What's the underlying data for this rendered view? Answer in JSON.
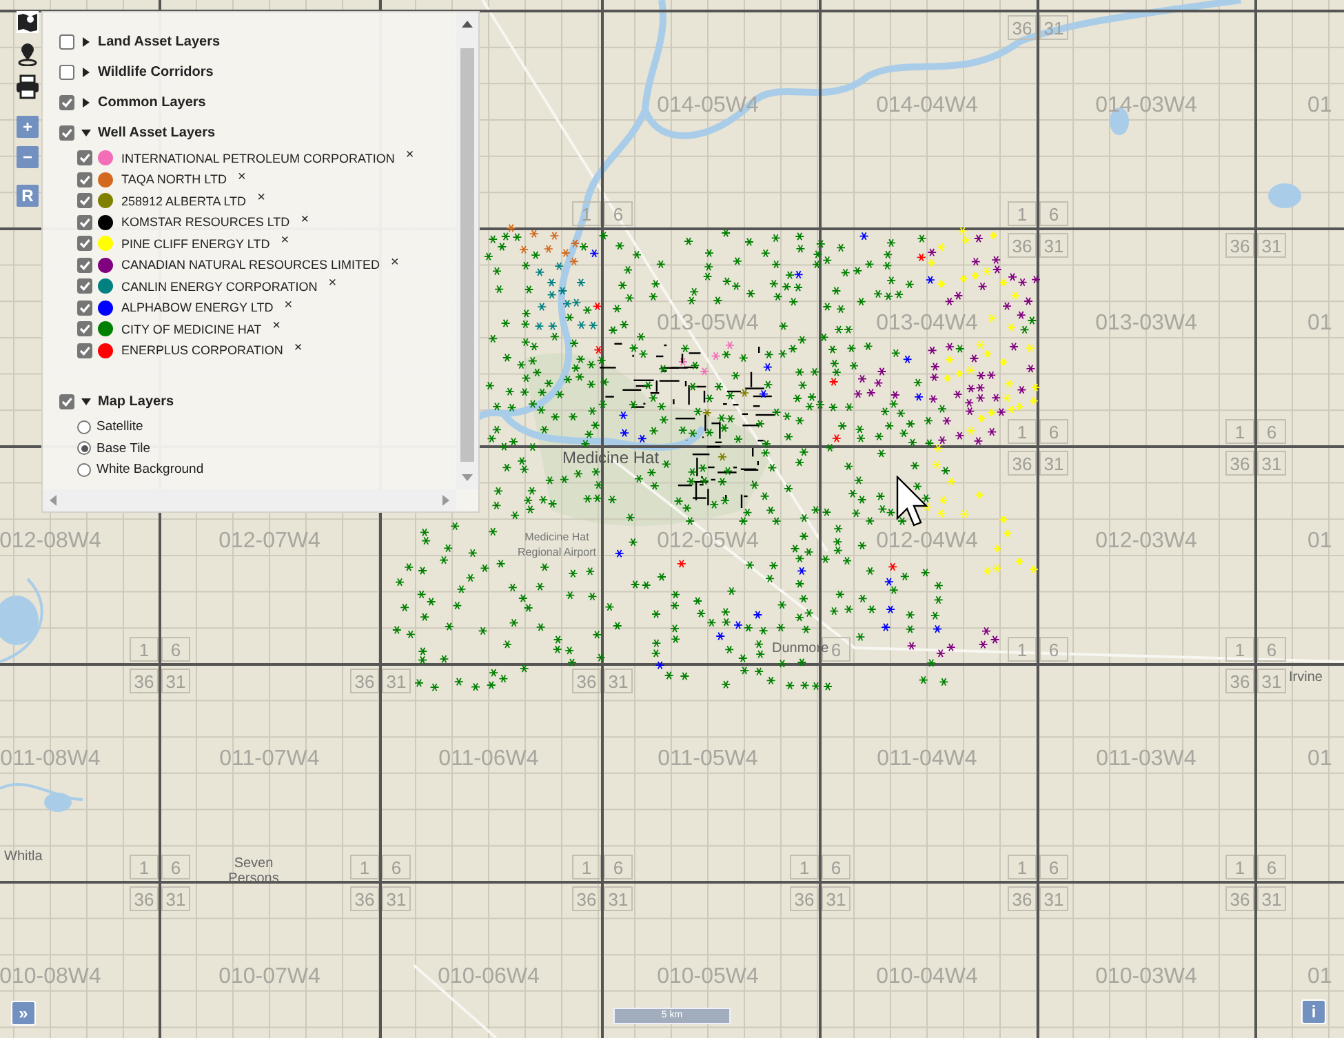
{
  "toolbar": {
    "zoom_in": "+",
    "zoom_out": "−",
    "reset": "R"
  },
  "layer_panel": {
    "groups": [
      {
        "kind": "folder",
        "label": "Land Asset Layers",
        "checked": false,
        "expanded": false
      },
      {
        "kind": "folder",
        "label": "Wildlife Corridors",
        "checked": false,
        "expanded": false
      },
      {
        "kind": "folder",
        "label": "Common Layers",
        "checked": true,
        "expanded": false
      },
      {
        "kind": "wells",
        "label": "Well Asset Layers",
        "checked": true,
        "expanded": true,
        "layers": [
          {
            "label": "INTERNATIONAL PETROLEUM CORPORATION",
            "color": "#f46db8",
            "checked": true,
            "remove": "×"
          },
          {
            "label": "TAQA NORTH LTD",
            "color": "#d2691e",
            "checked": true,
            "remove": "×"
          },
          {
            "label": "258912 ALBERTA LTD",
            "color": "#808000",
            "checked": true,
            "remove": "×"
          },
          {
            "label": "KOMSTAR RESOURCES LTD",
            "color": "#000000",
            "checked": true,
            "remove": "×"
          },
          {
            "label": "PINE CLIFF ENERGY LTD",
            "color": "#ffff00",
            "checked": true,
            "remove": "×"
          },
          {
            "label": "CANADIAN NATURAL RESOURCES LIMITED",
            "color": "#800080",
            "checked": true,
            "remove": "×"
          },
          {
            "label": "CANLIN ENERGY CORPORATION",
            "color": "#008080",
            "checked": true,
            "remove": "×"
          },
          {
            "label": "ALPHABOW ENERGY LTD",
            "color": "#0000ff",
            "checked": true,
            "remove": "×"
          },
          {
            "label": "CITY OF MEDICINE HAT",
            "color": "#008000",
            "checked": true,
            "remove": "×"
          },
          {
            "label": "ENERPLUS CORPORATION",
            "color": "#ff0000",
            "checked": true,
            "remove": "×"
          }
        ]
      },
      {
        "kind": "basemaps",
        "label": "Map Layers",
        "checked": true,
        "expanded": true,
        "options": [
          {
            "label": "Satellite",
            "selected": false
          },
          {
            "label": "Base Tile",
            "selected": true
          },
          {
            "label": "White Background",
            "selected": false
          }
        ]
      }
    ]
  },
  "map": {
    "townships": [
      {
        "label": "014-05W4"
      },
      {
        "label": "014-04W4"
      },
      {
        "label": "014-03W4"
      },
      {
        "label": "01"
      },
      {
        "label": "013-05W4"
      },
      {
        "label": "013-04W4"
      },
      {
        "label": "013-03W4"
      },
      {
        "label": "01"
      },
      {
        "label": "012-08W4"
      },
      {
        "label": "012-07W4"
      },
      {
        "label": "012-05W4"
      },
      {
        "label": "012-04W4"
      },
      {
        "label": "012-03W4"
      },
      {
        "label": "01"
      },
      {
        "label": "011-08W4"
      },
      {
        "label": "011-07W4"
      },
      {
        "label": "011-06W4"
      },
      {
        "label": "011-05W4"
      },
      {
        "label": "011-04W4"
      },
      {
        "label": "011-03W4"
      },
      {
        "label": "01"
      },
      {
        "label": "010-08W4"
      },
      {
        "label": "010-07W4"
      },
      {
        "label": "010-06W4"
      },
      {
        "label": "010-05W4"
      },
      {
        "label": "010-04W4"
      },
      {
        "label": "010-03W4"
      },
      {
        "label": "01"
      }
    ],
    "section_corners": [
      {
        "sw": "36",
        "se": "31"
      },
      {
        "nw": "1",
        "ne": "6"
      },
      {
        "nw": "1",
        "ne": "6",
        "sw": "36",
        "se": "31"
      },
      {
        "sw": "36",
        "se": "31"
      },
      {
        "nw": "1",
        "ne": "6",
        "sw": "36",
        "se": "31"
      },
      {
        "nw": "1",
        "ne": "6",
        "sw": "36",
        "se": "31"
      },
      {
        "nw": "1",
        "ne": "6",
        "sw": "36",
        "se": "31"
      },
      {
        "sw": "36",
        "se": "31"
      },
      {
        "sw": "36",
        "se": "31"
      },
      {
        "ne": "6"
      },
      {
        "nw": "1",
        "ne": "6"
      },
      {
        "nw": "1",
        "ne": "6",
        "sw": "36",
        "se": "31"
      },
      {
        "nw": "1",
        "ne": "6",
        "sw": "36",
        "se": "31"
      },
      {
        "nw": "1",
        "ne": "6",
        "sw": "36",
        "se": "31"
      },
      {
        "nw": "1",
        "ne": "6",
        "sw": "36",
        "se": "31"
      },
      {
        "nw": "1",
        "ne": "6",
        "sw": "36",
        "se": "31"
      },
      {
        "nw": "1",
        "ne": "6",
        "sw": "36",
        "se": "31"
      },
      {
        "nw": "1",
        "ne": "6",
        "sw": "36",
        "se": "31"
      }
    ],
    "places": [
      {
        "label": "Medicine Hat"
      },
      {
        "label": "Medicine Hat Regional Airport"
      },
      {
        "label": "Dunmore"
      },
      {
        "label": "Irvine"
      },
      {
        "label": "Whitla"
      },
      {
        "label": "Seven Persons"
      }
    ],
    "scale": "5 km"
  },
  "expand_button": "»",
  "info_button": "i"
}
